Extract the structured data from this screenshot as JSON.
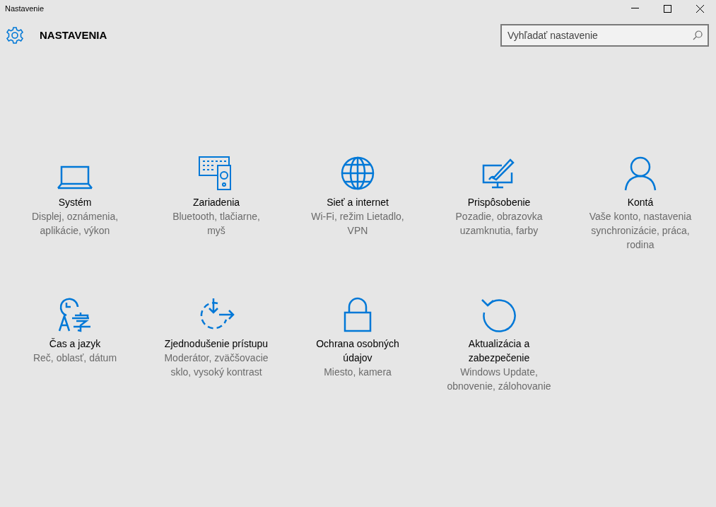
{
  "window": {
    "title": "Nastavenie"
  },
  "header": {
    "title": "NASTAVENIA"
  },
  "search": {
    "placeholder": "Vyhľadať nastavenie"
  },
  "categories": [
    {
      "kind": "laptop",
      "title": "Systém",
      "description": "Displej, oznámenia, aplikácie, výkon"
    },
    {
      "kind": "devices",
      "title": "Zariadenia",
      "description": "Bluetooth, tlačiarne, myš"
    },
    {
      "kind": "globe",
      "title": "Sieť a internet",
      "description": "Wi-Fi, režim Lietadlo, VPN"
    },
    {
      "kind": "personalize",
      "title": "Prispôsobenie",
      "description": "Pozadie, obrazovka uzamknutia, farby"
    },
    {
      "kind": "person",
      "title": "Kontá",
      "description": "Vaše konto, nastavenia synchronizácie, práca, rodina"
    },
    {
      "kind": "time",
      "title": "Čas a jazyk",
      "description": "Reč, oblasť, dátum"
    },
    {
      "kind": "access",
      "title": "Zjednodušenie prístupu",
      "description": "Moderátor, zväčšovacie sklo, vysoký kontrast"
    },
    {
      "kind": "lock",
      "title": "Ochrana osobných údajov",
      "description": "Miesto, kamera"
    },
    {
      "kind": "update",
      "title": "Aktualizácia a zabezpečenie",
      "description": "Windows Update, obnovenie, zálohovanie"
    }
  ]
}
